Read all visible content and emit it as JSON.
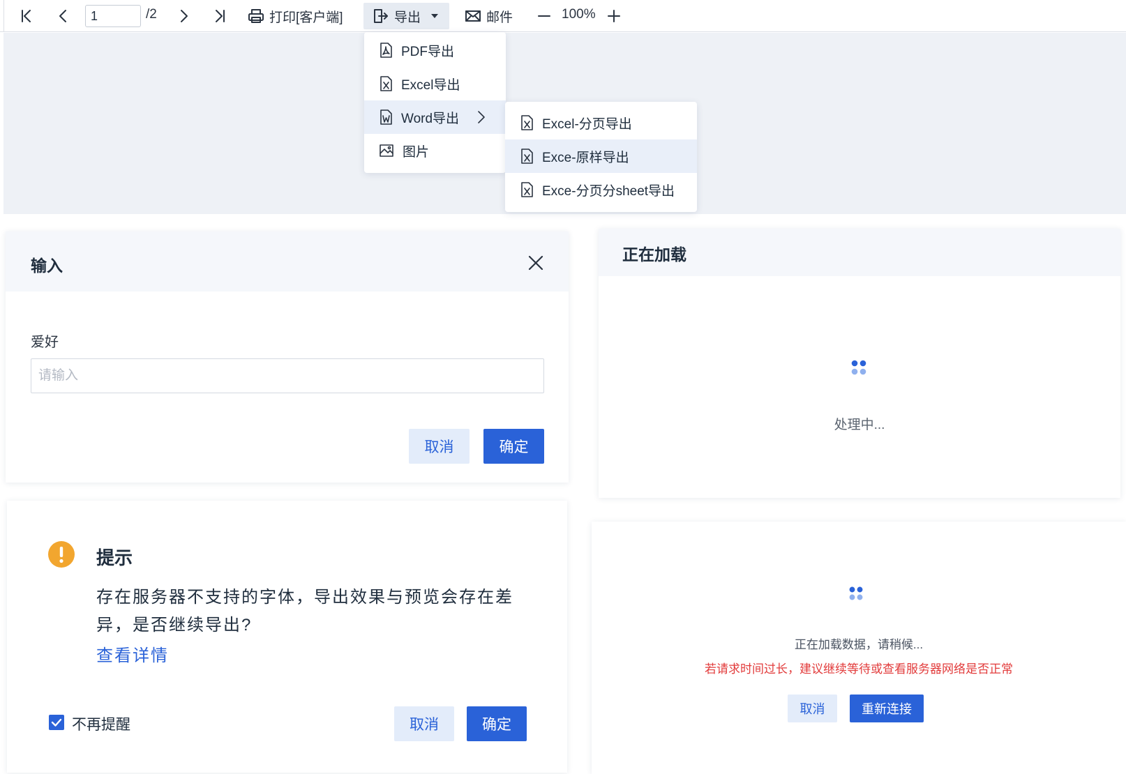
{
  "toolbar": {
    "page_current": "1",
    "page_total": "/2",
    "print_label": "打印[客户端]",
    "export_label": "导出",
    "mail_label": "邮件",
    "zoom": "100%"
  },
  "export_menu": {
    "items": [
      {
        "label": "PDF导出",
        "icon": "pdf-file-icon"
      },
      {
        "label": "Excel导出",
        "icon": "excel-file-icon"
      },
      {
        "label": "Word导出",
        "icon": "word-file-icon",
        "active": true,
        "has_submenu": true
      },
      {
        "label": "图片",
        "icon": "image-icon"
      }
    ]
  },
  "word_submenu": {
    "items": [
      {
        "label": "Excel-分页导出",
        "icon": "excel-file-icon"
      },
      {
        "label": "Exce-原样导出",
        "icon": "excel-file-icon",
        "active": true
      },
      {
        "label": "Exce-分页分sheet导出",
        "icon": "excel-file-icon"
      }
    ]
  },
  "input_dialog": {
    "title": "输入",
    "field_label": "爱好",
    "field_value": "",
    "field_placeholder": "请输入",
    "cancel_label": "取消",
    "ok_label": "确定"
  },
  "loading_panel": {
    "title": "正在加载",
    "status": "处理中..."
  },
  "tip_dialog": {
    "title": "提示",
    "message": "存在服务器不支持的字体，导出效果与预览会存在差异，是否继续导出?",
    "detail_link": "查看详情",
    "dont_remind_label": "不再提醒",
    "dont_remind_checked": true,
    "cancel_label": "取消",
    "ok_label": "确定"
  },
  "reconnect_panel": {
    "loading_text": "正在加载数据，请稍候...",
    "warning_text": "若请求时间过长，建议继续等待或查看服务器网络是否正常",
    "cancel_label": "取消",
    "reconnect_label": "重新连接"
  },
  "colors": {
    "primary": "#2a62d8",
    "primary_light": "#e3ecfa",
    "warning": "#f2a62f",
    "error_text": "#e23b3b",
    "preview_bg": "#eef1f6",
    "menu_active_bg": "#e9eff9"
  }
}
